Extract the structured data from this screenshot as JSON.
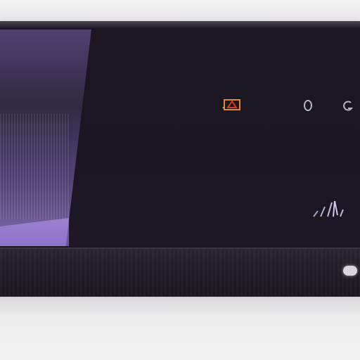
{
  "scene": {
    "icons": [
      "alarm-icon",
      "circle-icon",
      "g-icon",
      "signal-mark-icon",
      "power-led-icon"
    ],
    "colors": {
      "screen": "#1a1521",
      "bezel": "#231e2a",
      "reflection": "#8c78c8",
      "alarm_orange": "#e08a2e",
      "alarm_red": "#d23a2a",
      "status_gray": "#b9b6c4",
      "led": "#d9d6df",
      "wall": "#e9e7e8"
    }
  }
}
